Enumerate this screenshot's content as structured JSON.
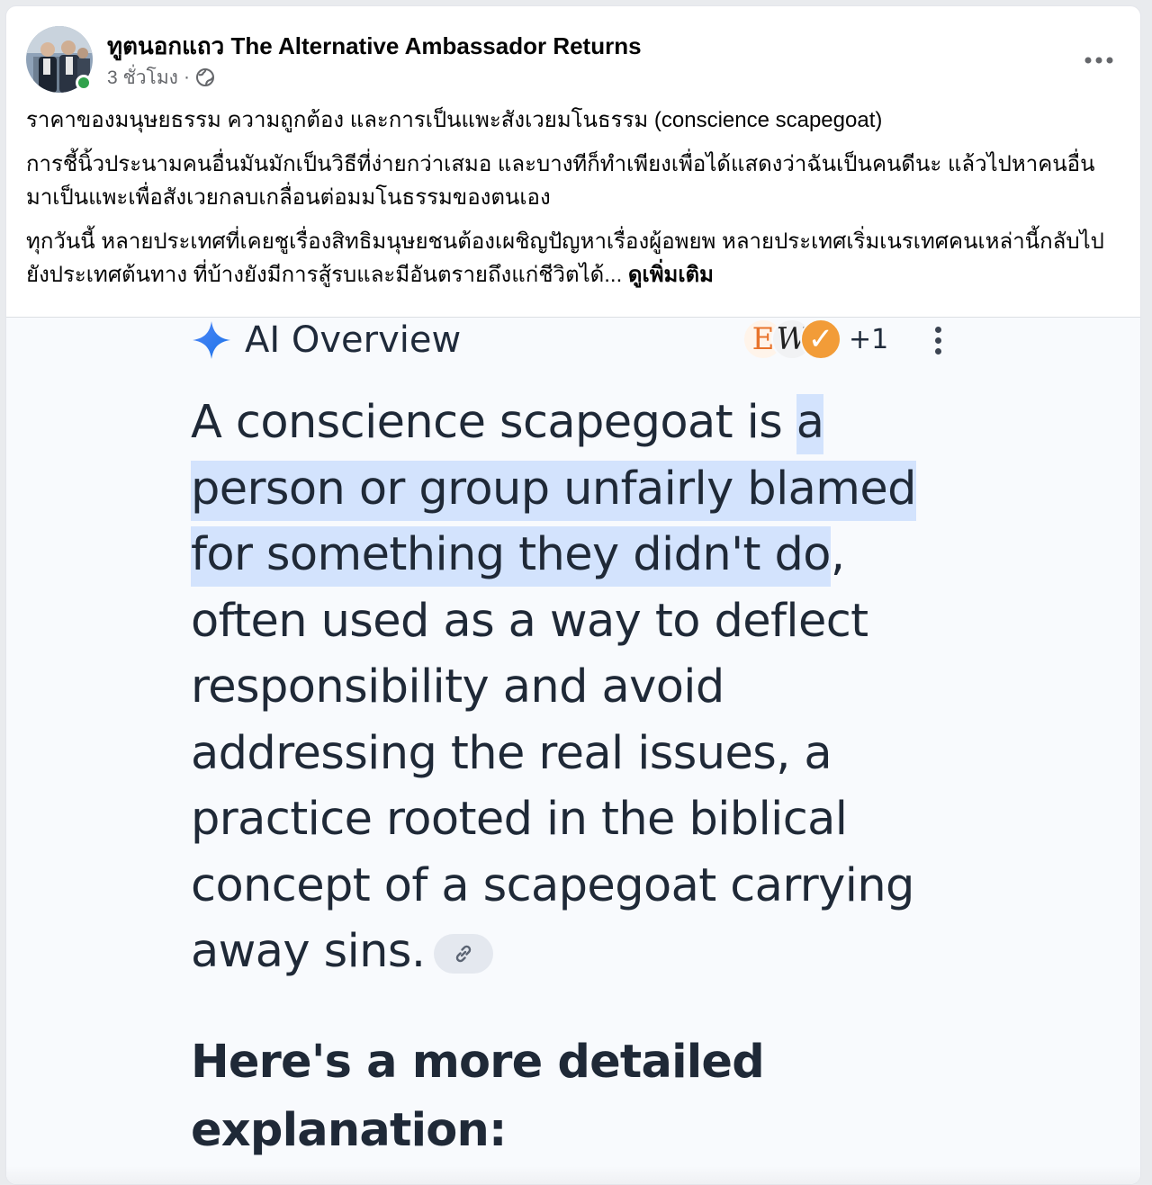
{
  "post": {
    "page_name": "ทูตนอกแถว The Alternative Ambassador Returns",
    "timestamp": "3 ชั่วโมง",
    "separator": "·",
    "audience_icon": "globe-icon",
    "more_icon": "more-horizontal-icon",
    "online": true,
    "paragraphs": [
      "ราคาของมนุษยธรรม ความถูกต้อง และการเป็นแพะสังเวยมโนธรรม (conscience scapegoat)",
      "การชี้นิ้วประนามคนอื่นมันมักเป็นวิธีที่ง่ายกว่าเสมอ และบางทีก็ทำเพียงเพื่อได้แสดงว่าฉันเป็นคนดีนะ แล้วไปหาคนอื่นมาเป็นแพะเพื่อสังเวยกลบเกลื่อนต่อมมโนธรรมของตนเอง",
      "ทุกวันนี้ หลายประเทศที่เคยชูเรื่องสิทธิมนุษยชนต้องเผชิญปัญหาเรื่องผู้อพยพ หลายประเทศเริ่มเนรเทศคนเหล่านี้กลับไปยังประเทศต้นทาง ที่บ้างยังมีการสู้รบและมีอันตรายถึงแก่ชีวิตได้..."
    ],
    "see_more": "ดูเพิ่มเติม"
  },
  "ai_overview": {
    "title": "AI Overview",
    "sparkle_icon": "sparkle-icon",
    "source_badges": [
      "E",
      "W",
      "✓"
    ],
    "extra_sources": "+1",
    "menu_icon": "more-vertical-icon",
    "text_before": "A conscience scapegoat is ",
    "text_highlight": "a person or group unfairly blamed for something they didn't do",
    "text_after": ", often used as a way to deflect responsibility and avoid addressing the real issues, a practice rooted in the biblical concept of a scapegoat carrying away sins.",
    "link_icon": "link-icon",
    "subheading": "Here's a more detailed explanation:",
    "highlight_color": "#d3e3fd",
    "accent_color": "#1a73e8"
  }
}
